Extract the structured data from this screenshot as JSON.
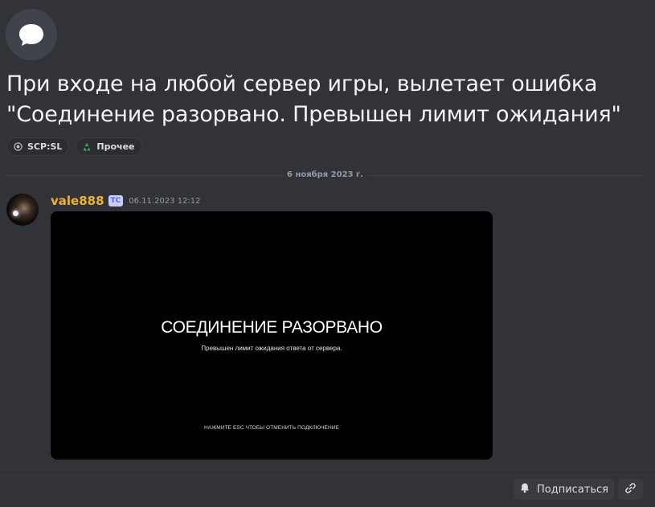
{
  "thread": {
    "icon": "chat-bubble-icon",
    "title": "При входе на любой сервер игры, вылетает ошибка \"Соединение разорвано. Превышен лимит ожидания\""
  },
  "tags": [
    {
      "icon": "scp-logo-icon",
      "label": "SCP:SL"
    },
    {
      "icon": "recycle-icon",
      "label": "Прочее"
    }
  ],
  "divider": {
    "date": "6 ноября 2023 г."
  },
  "message": {
    "author": "vale888",
    "badge": "ТС",
    "timestamp": "06.11.2023 12:12",
    "attachment": {
      "title": "СОЕДИНЕНИЕ РАЗОРВАНО",
      "subtitle": "Превышен лимит ожидания ответа от сервера.",
      "hint": "НАЖМИТЕ ESC ЧТОБЫ ОТМЕНИТЬ ПОДКЛЮЧЕНИЕ"
    }
  },
  "footer": {
    "follow_label": "Подписаться",
    "follow_icon": "bell-icon",
    "link_icon": "link-icon"
  },
  "colors": {
    "background": "#313338",
    "username": "#f0b232",
    "badge_bg": "#c9cdfb",
    "badge_text": "#5865f2"
  }
}
